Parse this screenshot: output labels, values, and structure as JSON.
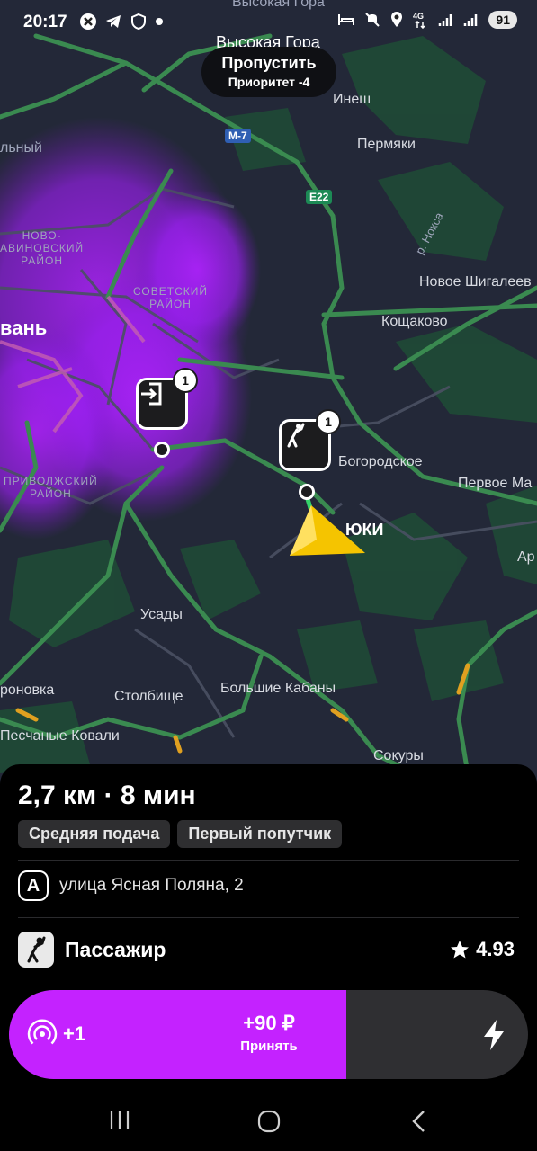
{
  "status_bar": {
    "time": "20:17",
    "left_icons": [
      "cross-circle-icon",
      "telegram-icon",
      "shield-icon",
      "dot-icon"
    ],
    "right_icons": [
      "bed-icon",
      "mute-icon",
      "location-icon",
      "4g-icon",
      "signal-icon",
      "signal-icon"
    ],
    "battery": "91"
  },
  "skip_pill": {
    "title": "Пропустить",
    "subtitle": "Приоритет -4"
  },
  "map": {
    "labels": {
      "vysokaya_gora_top": "Высокая Гора",
      "vysokaya_gora": "Высокая Гора",
      "inesh": "Инеш",
      "permyaki": "Пермяки",
      "r_noksa": "р. Нокса",
      "novoe_shigaleevo": "Новое Шигалеев",
      "koshchakovo": "Кощаково",
      "bogorodskoe": "Богородское",
      "pervoe_may": "Первое Ма",
      "ar": "Ар",
      "kazan": "вань",
      "novo_savinovsky": "НОВО-\nАВИНОВСКИЙ\nРАЙОН",
      "sovetsky": "СОВЕТСКИЙ\nРАЙОН",
      "privolzhsky": "ПРИВОЛЖСКИЙ\nРАЙОН",
      "yuki": "ЮКИ",
      "usady": "Усады",
      "ronovka": "роновка",
      "stolbishche": "Столбище",
      "bolshie_kabany": "Большие Кабаны",
      "peschanye_kovali": "Песчаные Ковали",
      "sokury": "Сокуры",
      "lny": "льный"
    },
    "road_badges": {
      "m7": "М-7",
      "e22": "E22"
    },
    "markers": {
      "dropoff_badge": "1",
      "pickup_badge": "1"
    }
  },
  "order": {
    "eta": "2,7 км · 8 мин",
    "tags": [
      "Средняя подача",
      "Первый попутчик"
    ],
    "address_badge": "A",
    "address": "улица Ясная Поляна, 2",
    "passenger_label": "Пассажир",
    "rating": "4.93"
  },
  "accept": {
    "boost": "+1",
    "price": "+90 ₽",
    "label": "Принять",
    "progress": 0.65,
    "color": "#c422ff"
  },
  "colors": {
    "accent": "#c422ff",
    "arrow": "#f5c400",
    "traffic_green": "#3fa35a"
  }
}
